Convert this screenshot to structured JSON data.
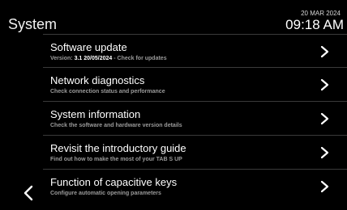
{
  "header": {
    "title": "System",
    "date": "20 MAR 2024",
    "time": "09:18 AM"
  },
  "menu": {
    "items": [
      {
        "label": "Software update",
        "sub_prefix": "Version: ",
        "sub_version": "3.1 20/05/2024",
        "sub_suffix": " - Check for updates"
      },
      {
        "label": "Network diagnostics",
        "sub": "Check connection status and performance"
      },
      {
        "label": "System information",
        "sub": "Check the software and hardware version details"
      },
      {
        "label": "Revisit the introductory guide",
        "sub": "Find out how to make the most of your TAB S UP"
      },
      {
        "label": "Function of capacitive keys",
        "sub": "Configure automatic opening parameters"
      }
    ]
  },
  "icons": {
    "chevron": "chevron-right-icon",
    "back": "chevron-left-icon"
  }
}
